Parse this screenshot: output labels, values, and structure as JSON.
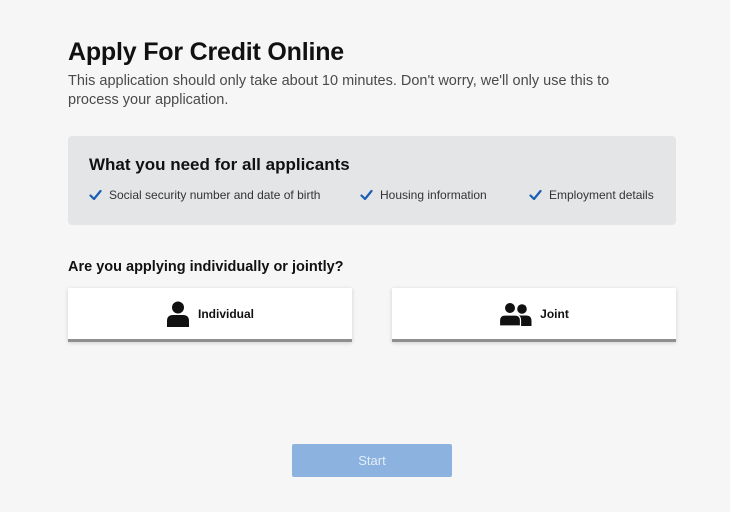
{
  "page": {
    "title": "Apply For Credit Online",
    "intro": "This application should only take about 10 minutes. Don't worry, we'll only use this to process your application."
  },
  "requirements": {
    "title": "What you need for all applicants",
    "items": [
      {
        "label": "Social security number and date of birth",
        "icon": "checkmark-icon"
      },
      {
        "label": "Housing information",
        "icon": "checkmark-icon"
      },
      {
        "label": "Employment details",
        "icon": "checkmark-icon"
      }
    ]
  },
  "applicant_type": {
    "question": "Are you applying individually or jointly?",
    "options": [
      {
        "label": "Individual",
        "icon": "single-person-icon"
      },
      {
        "label": "Joint",
        "icon": "two-people-icon"
      }
    ]
  },
  "start_button": {
    "label": "Start",
    "state": "disabled"
  },
  "colors": {
    "background": "#f6f6f6",
    "panel": "#e4e5e7",
    "check": "#1a5fb4",
    "start_disabled": "#8cb3e0"
  }
}
